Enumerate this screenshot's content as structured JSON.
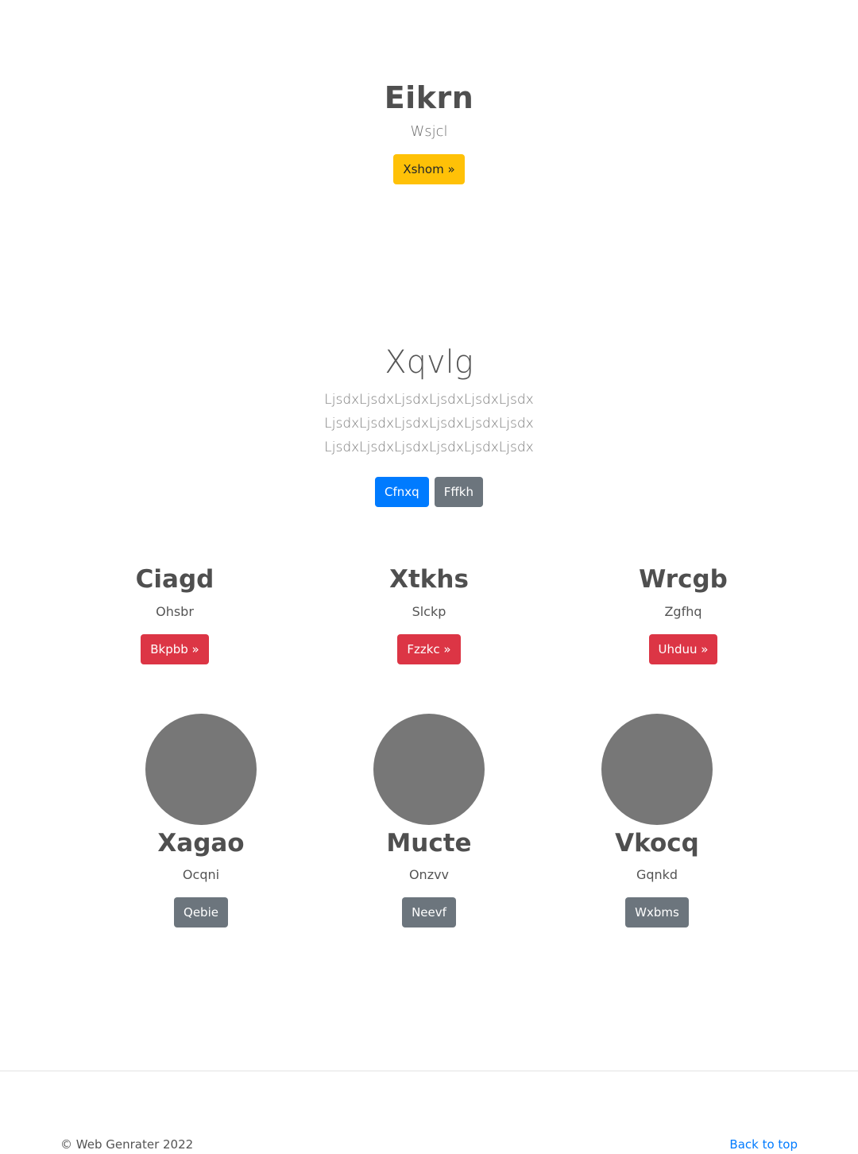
{
  "hero": {
    "title": "Eikrn",
    "subtitle": "Wsjcl",
    "button_label": "Xshom »"
  },
  "jumbotron": {
    "title": "Xqvlg",
    "lead": "LjsdxLjsdxLjsdxLjsdxLjsdxLjsdx LjsdxLjsdxLjsdxLjsdxLjsdxLjsdx LjsdxLjsdxLjsdxLjsdxLjsdxLjsdx",
    "primary_label": "Cfnxq",
    "secondary_label": "Fffkh"
  },
  "features": [
    {
      "title": "Ciagd",
      "text": "Ohsbr",
      "button_label": "Bkpbb »"
    },
    {
      "title": "Xtkhs",
      "text": "Slckp",
      "button_label": "Fzzkc »"
    },
    {
      "title": "Wrcgb",
      "text": "Zgfhq",
      "button_label": "Uhduu »"
    }
  ],
  "team": [
    {
      "name": "Xagao",
      "text": "Ocqni",
      "button_label": "Qebie"
    },
    {
      "name": "Mucte",
      "text": "Onzvv",
      "button_label": "Neevf"
    },
    {
      "name": "Vkocq",
      "text": "Gqnkd",
      "button_label": "Wxbms"
    }
  ],
  "footer": {
    "copyright": "© Web Genrater 2022",
    "back_to_top": "Back to top"
  },
  "colors": {
    "warning": "#ffc107",
    "primary": "#007bff",
    "secondary": "#6c757d",
    "danger": "#dc3545",
    "avatar": "#777777"
  }
}
